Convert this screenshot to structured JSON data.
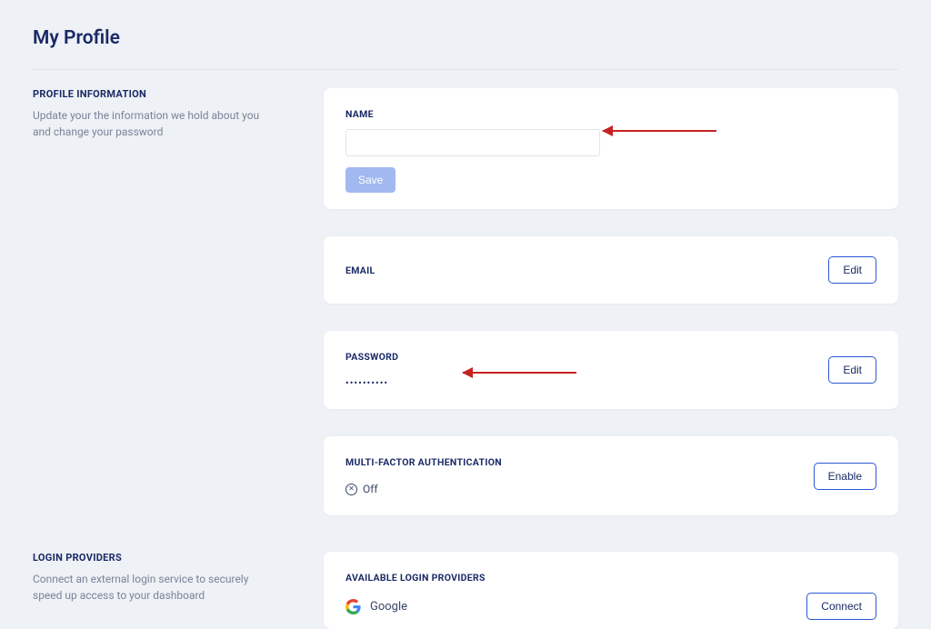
{
  "page_title": "My Profile",
  "profile_info": {
    "heading": "PROFILE INFORMATION",
    "description": "Update your the information we hold about you and change your password",
    "name_card": {
      "label": "NAME",
      "value": "",
      "save_label": "Save"
    },
    "email_card": {
      "label": "EMAIL",
      "edit_label": "Edit"
    },
    "password_card": {
      "label": "PASSWORD",
      "masked": "••••••••••",
      "edit_label": "Edit"
    },
    "mfa_card": {
      "label": "MULTI-FACTOR AUTHENTICATION",
      "status": "Off",
      "enable_label": "Enable"
    }
  },
  "login_providers": {
    "heading": "LOGIN PROVIDERS",
    "description": "Connect an external login service to securely speed up access to your dashboard",
    "available_label": "AVAILABLE LOGIN PROVIDERS",
    "providers": [
      {
        "name": "Google",
        "action": "Connect"
      }
    ]
  }
}
